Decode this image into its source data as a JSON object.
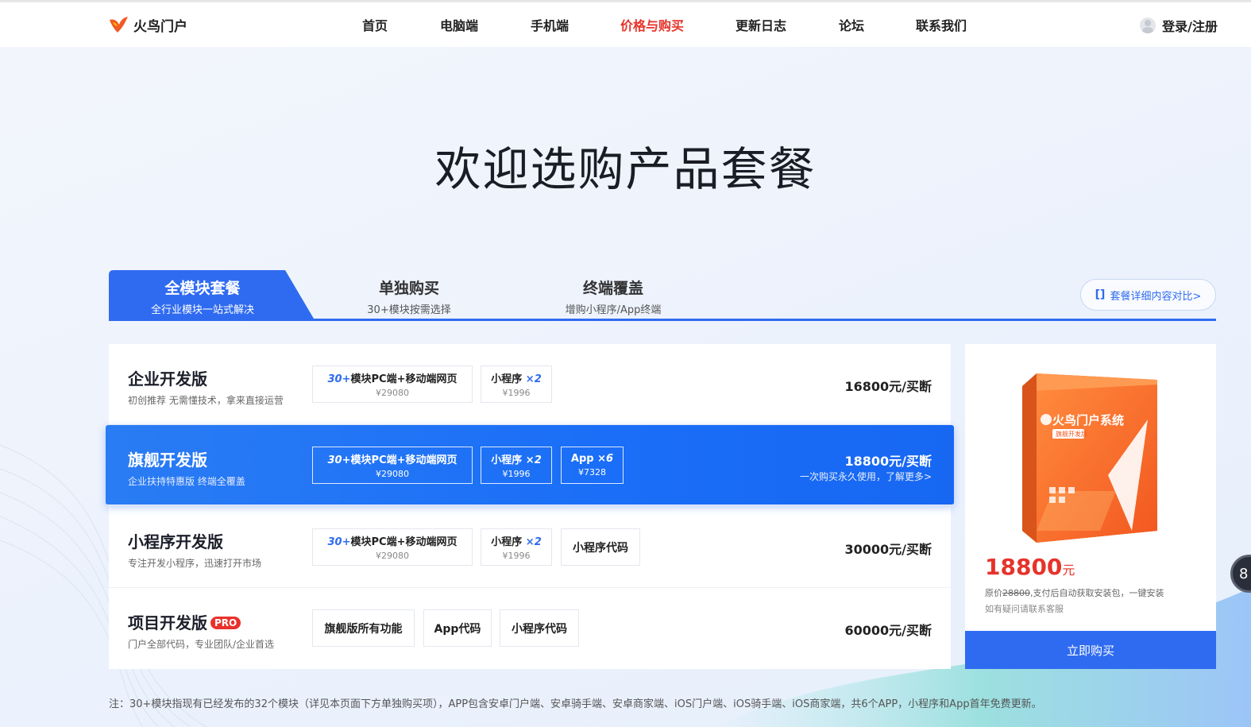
{
  "header": {
    "logo_text": "火鸟门户",
    "nav": [
      {
        "label": "首页",
        "active": false
      },
      {
        "label": "电脑端",
        "active": false
      },
      {
        "label": "手机端",
        "active": false
      },
      {
        "label": "价格与购买",
        "active": true
      },
      {
        "label": "更新日志",
        "active": false
      },
      {
        "label": "论坛",
        "active": false
      },
      {
        "label": "联系我们",
        "active": false
      }
    ],
    "login_label": "登录/注册"
  },
  "hero": {
    "title": "欢迎选购产品套餐"
  },
  "tabs": [
    {
      "title": "全模块套餐",
      "subtitle": "全行业模块一站式解决",
      "active": true
    },
    {
      "title": "单独购买",
      "subtitle": "30+模块按需选择",
      "active": false
    },
    {
      "title": "终端覆盖",
      "subtitle": "增购小程序/App终端",
      "active": false
    }
  ],
  "compare_button": {
    "icon": "[]",
    "label": "套餐详细内容对比>"
  },
  "plans": [
    {
      "name": "企业开发版",
      "desc": "初创推荐 无需懂技术，拿来直接运营",
      "chips": [
        {
          "line1_prefix": "30+",
          "line1": "模块PC端+移动端网页",
          "line2": "¥29080"
        },
        {
          "line1": "小程序",
          "multiplier": "×2",
          "line2": "¥1996"
        }
      ],
      "price": "16800元/买断"
    },
    {
      "name": "旗舰开发版",
      "desc": "企业扶持特惠版 终端全覆盖",
      "chips": [
        {
          "line1_prefix": "30+",
          "line1": "模块PC端+移动端网页",
          "line2": "¥29080"
        },
        {
          "line1": "小程序",
          "multiplier": "×2",
          "line2": "¥1996"
        },
        {
          "line1": "App",
          "multiplier": "×6",
          "line2": "¥7328"
        }
      ],
      "price": "18800元/买断",
      "more": "一次购买永久使用，了解更多>"
    },
    {
      "name": "小程序开发版",
      "desc": "专注开发小程序，迅速打开市场",
      "chips": [
        {
          "line1_prefix": "30+",
          "line1": "模块PC端+移动端网页",
          "line2": "¥29080"
        },
        {
          "line1": "小程序",
          "multiplier": "×2",
          "line2": "¥1996"
        },
        {
          "single": "小程序代码"
        }
      ],
      "price": "30000元/买断"
    },
    {
      "name": "项目开发版",
      "badge": "PRO",
      "desc": "门户全部代码，专业团队/企业首选",
      "chips": [
        {
          "single": "旗舰版所有功能"
        },
        {
          "single": "App代码"
        },
        {
          "single": "小程序代码"
        }
      ],
      "price": "60000元/买断"
    }
  ],
  "product_card": {
    "box_title": "火鸟门户系统",
    "box_subtitle": "旗舰开发版",
    "price": "18800",
    "price_unit": "元",
    "note_prefix": "原价",
    "original_price": "28800",
    "note_rest": ",支付后自动获取安装包，一键安装",
    "note2": "如有疑问请联系客服",
    "buy_label": "立即购买"
  },
  "footnote": "注：30+模块指现有已经发布的32个模块（详见本页面下方单独购买项），APP包含安卓门户端、安卓骑手端、安卓商家端、iOS门户端、iOS骑手端、iOS商家端，共6个APP，小程序和App首年免费更新。",
  "float_bubble": "8",
  "colors": {
    "accent": "#2f6bf0",
    "active_nav": "#e6332a",
    "price_red": "#e6332a"
  }
}
